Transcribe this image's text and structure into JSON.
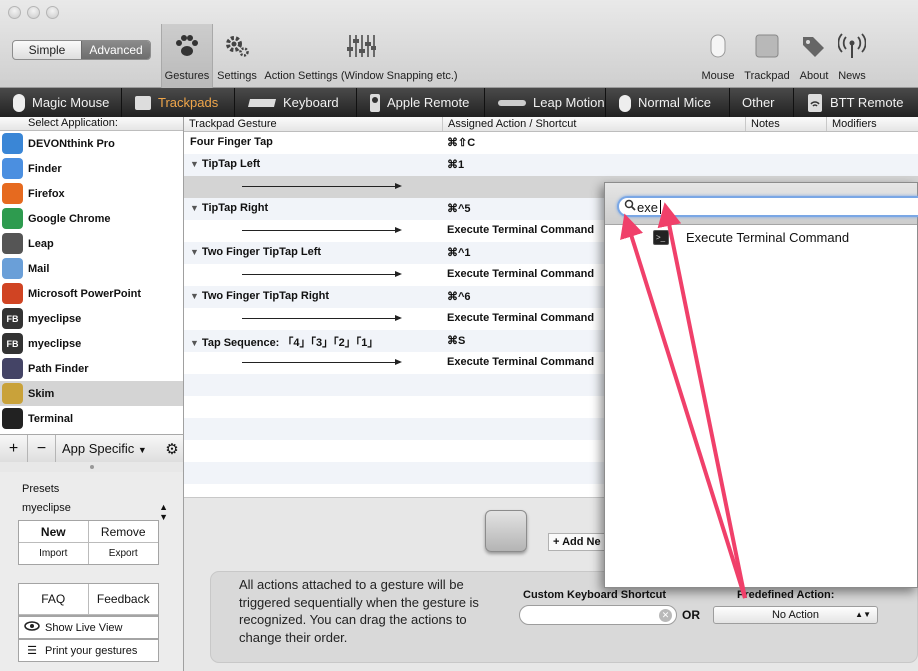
{
  "toolbar": {
    "mode": {
      "simple": "Simple",
      "advanced": "Advanced"
    },
    "left_buttons": [
      {
        "label": "Gestures",
        "icon": "paw-icon"
      },
      {
        "label": "Settings",
        "icon": "gear-icon"
      },
      {
        "label": "Action Settings (Window Snapping etc.)",
        "icon": "sliders-icon"
      }
    ],
    "right_buttons": [
      {
        "label": "Mouse",
        "icon": "mouse-icon"
      },
      {
        "label": "Trackpad",
        "icon": "trackpad-icon"
      },
      {
        "label": "About",
        "icon": "tag-icon"
      },
      {
        "label": "News",
        "icon": "antenna-icon"
      }
    ]
  },
  "tabs": [
    {
      "label": "Magic Mouse"
    },
    {
      "label": "Trackpads",
      "active": true
    },
    {
      "label": "Keyboard"
    },
    {
      "label": "Apple Remote"
    },
    {
      "label": "Leap Motion"
    },
    {
      "label": "Normal Mice"
    },
    {
      "label": "Other"
    },
    {
      "label": "BTT Remote"
    }
  ],
  "sidebar": {
    "header": "Select Application:",
    "apps": [
      {
        "name": "DEVONthink Pro",
        "color": "#3a86d6"
      },
      {
        "name": "Finder",
        "color": "#4b8fe0"
      },
      {
        "name": "Firefox",
        "color": "#e66a1f"
      },
      {
        "name": "Google Chrome",
        "color": "#2e9b4f"
      },
      {
        "name": "Leap",
        "color": "#555555"
      },
      {
        "name": "Mail",
        "color": "#6a9fd8"
      },
      {
        "name": "Microsoft PowerPoint",
        "color": "#d04423"
      },
      {
        "name": "myeclipse",
        "color": "#333333",
        "badge": "FB"
      },
      {
        "name": "myeclipse",
        "color": "#333333",
        "badge": "FB"
      },
      {
        "name": "Path Finder",
        "color": "#444466"
      },
      {
        "name": "Skim",
        "color": "#c9a23a",
        "selected": true
      },
      {
        "name": "Terminal",
        "color": "#222222"
      }
    ],
    "footer": {
      "add": "+",
      "remove": "−",
      "filter": "App Specific"
    }
  },
  "presets": {
    "title": "Presets",
    "current": "myeclipse",
    "new": "New",
    "remove": "Remove",
    "import": "Import",
    "export": "Export",
    "faq": "FAQ",
    "feedback": "Feedback",
    "live_view": "Show Live View",
    "print": "Print your gestures"
  },
  "table": {
    "headers": [
      "Trackpad Gesture",
      "Assigned Action / Shortcut",
      "Notes",
      "Modifiers"
    ],
    "rows": [
      {
        "gesture": "Four Finger Tap",
        "action": "⌘⇧C"
      },
      {
        "gesture": "TipTap Left",
        "action": "⌘1",
        "expandable": true
      },
      {
        "gesture": "",
        "action": "",
        "arrow": true,
        "selected": true
      },
      {
        "gesture": "TipTap Right",
        "action": "⌘^5",
        "expandable": true
      },
      {
        "gesture": "",
        "action": "Execute Terminal Command",
        "arrow": true
      },
      {
        "gesture": "Two Finger TipTap Left",
        "action": "⌘^1",
        "expandable": true
      },
      {
        "gesture": "",
        "action": "Execute Terminal Command",
        "arrow": true
      },
      {
        "gesture": "Two Finger TipTap Right",
        "action": "⌘^6",
        "expandable": true
      },
      {
        "gesture": "",
        "action": "Execute Terminal Command",
        "arrow": true
      },
      {
        "gesture": "Tap Sequence: 「4」「3」「2」「1」",
        "action": "⌘S",
        "expandable": true
      },
      {
        "gesture": "",
        "action": "Execute Terminal Command",
        "arrow": true
      }
    ],
    "empty_rows": 6
  },
  "bottom": {
    "add_button": "+ Add Ne",
    "info": "All actions attached to a gesture will be triggered sequentially when the gesture is recognized. You can drag the actions to change their order.",
    "custom_shortcut_label": "Custom Keyboard Shortcut",
    "or": "OR",
    "predefined_label": "Predefined Action:",
    "predefined_value": "No Action"
  },
  "popover": {
    "search_value": "exe",
    "result": "Execute Terminal Command"
  },
  "colors": {
    "active_tab": "#f0a64a",
    "annotation_arrow": "#f0406a",
    "focus_ring": "#7aa7e5"
  }
}
